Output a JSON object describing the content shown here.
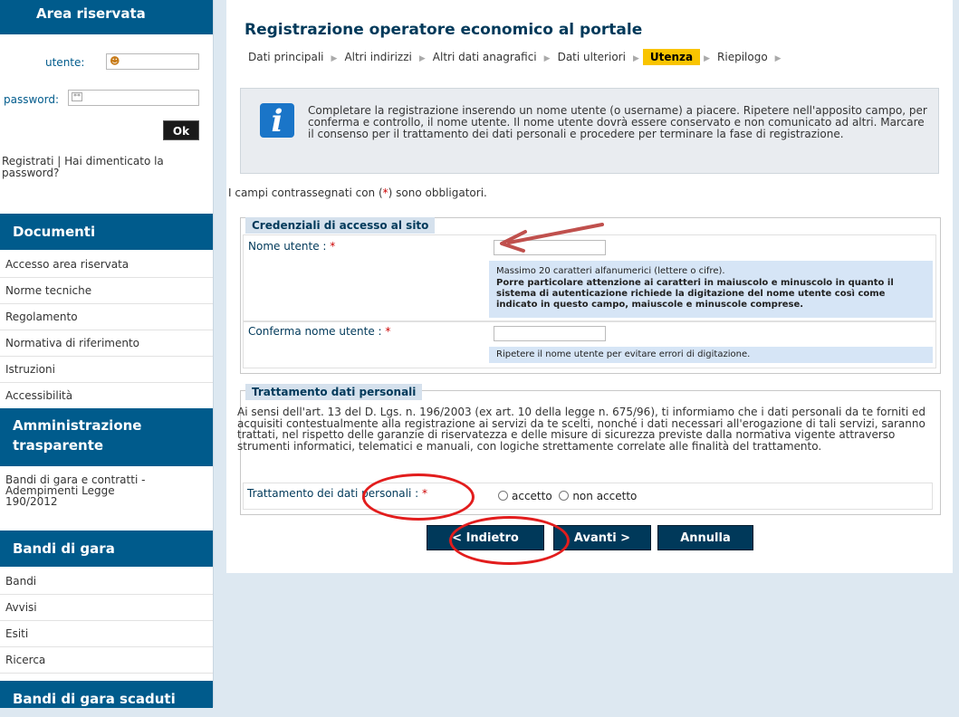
{
  "sidebar": {
    "area_title": "Area riservata",
    "user_label": "utente:",
    "password_label": "password:",
    "ok_label": "Ok",
    "register_text": "Registrati | Hai dimenticato la password?",
    "sections": [
      {
        "title": "Documenti",
        "items": [
          "Accesso area riservata",
          "Norme tecniche",
          "Regolamento",
          "Normativa di riferimento",
          "Istruzioni",
          "Accessibilità"
        ]
      },
      {
        "title": "Amministrazione trasparente",
        "items": [
          "Bandi di gara e contratti - Adempimenti Legge 190/2012"
        ]
      },
      {
        "title": "Bandi di gara",
        "items": [
          "Bandi",
          "Avvisi",
          "Esiti",
          "Ricerca"
        ]
      },
      {
        "title": "Bandi di gara scaduti",
        "items": []
      }
    ]
  },
  "main": {
    "title": "Registrazione operatore economico al portale",
    "steps": [
      "Dati principali",
      "Altri indirizzi",
      "Altri dati anagrafici",
      "Dati ulteriori",
      "Utenza",
      "Riepilogo"
    ],
    "active_step": "Utenza",
    "info_text": "Completare la registrazione inserendo un nome utente (o username) a piacere. Ripetere nell'apposito campo, per conferma e controllo, il nome utente. Il nome utente dovrà essere conservato e non comunicato ad altri. Marcare il consenso per il trattamento dei dati personali e procedere per terminare la fase di registrazione.",
    "mandatory_pre": "I campi contrassegnati con (",
    "mandatory_star": "*",
    "mandatory_post": ") sono obbligatori.",
    "credentials": {
      "legend": "Credenziali di accesso al sito",
      "username_label": "Nome utente : ",
      "username_hint_1": "Massimo 20 caratteri alfanumerici (lettere o cifre).",
      "username_hint_2": "Porre particolare attenzione ai caratteri in maiuscolo e minuscolo in quanto il sistema di autenticazione richiede la digitazione del nome utente così come indicato in questo campo, maiuscole e minuscole comprese.",
      "confirm_label": "Conferma nome utente : ",
      "confirm_hint": "Ripetere il nome utente per evitare errori di digitazione.",
      "star": "*"
    },
    "privacy": {
      "legend": "Trattamento dati personali",
      "text": "Ai sensi dell'art. 13 del D. Lgs. n. 196/2003 (ex art. 10 della legge n. 675/96), ti informiamo che i dati personali da te forniti ed acquisiti contestualmente alla registrazione ai servizi da te scelti, nonché i dati necessari all'erogazione di tali servizi, saranno trattati, nel rispetto delle garanzie di riservatezza e delle misure di sicurezza previste dalla normativa vigente attraverso strumenti informatici, telematici e manuali, con logiche strettamente correlate alle finalità del trattamento.",
      "consent_label": "Trattamento dei dati personali : ",
      "star": "*",
      "accept": "accetto",
      "reject": "non accetto"
    },
    "buttons": {
      "back": "< Indietro",
      "next": "Avanti >",
      "cancel": "Annulla"
    }
  },
  "colors": {
    "sidebar_header": "#005b8c",
    "active_step": "#f9c400",
    "button": "#00395a",
    "annotation": "#e21d1d",
    "hint_bg": "#d6e5f6"
  }
}
